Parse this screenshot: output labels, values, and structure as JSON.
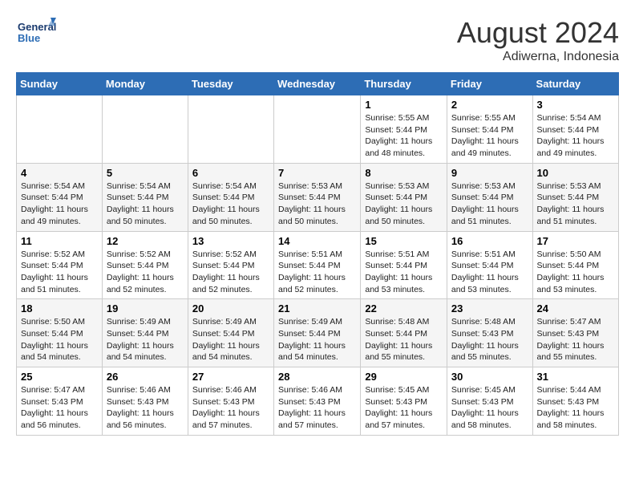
{
  "header": {
    "logo_line1": "General",
    "logo_line2": "Blue",
    "month": "August 2024",
    "location": "Adiwerna, Indonesia"
  },
  "weekdays": [
    "Sunday",
    "Monday",
    "Tuesday",
    "Wednesday",
    "Thursday",
    "Friday",
    "Saturday"
  ],
  "weeks": [
    [
      {
        "day": "",
        "info": ""
      },
      {
        "day": "",
        "info": ""
      },
      {
        "day": "",
        "info": ""
      },
      {
        "day": "",
        "info": ""
      },
      {
        "day": "1",
        "info": "Sunrise: 5:55 AM\nSunset: 5:44 PM\nDaylight: 11 hours and 48 minutes."
      },
      {
        "day": "2",
        "info": "Sunrise: 5:55 AM\nSunset: 5:44 PM\nDaylight: 11 hours and 49 minutes."
      },
      {
        "day": "3",
        "info": "Sunrise: 5:54 AM\nSunset: 5:44 PM\nDaylight: 11 hours and 49 minutes."
      }
    ],
    [
      {
        "day": "4",
        "info": "Sunrise: 5:54 AM\nSunset: 5:44 PM\nDaylight: 11 hours and 49 minutes."
      },
      {
        "day": "5",
        "info": "Sunrise: 5:54 AM\nSunset: 5:44 PM\nDaylight: 11 hours and 50 minutes."
      },
      {
        "day": "6",
        "info": "Sunrise: 5:54 AM\nSunset: 5:44 PM\nDaylight: 11 hours and 50 minutes."
      },
      {
        "day": "7",
        "info": "Sunrise: 5:53 AM\nSunset: 5:44 PM\nDaylight: 11 hours and 50 minutes."
      },
      {
        "day": "8",
        "info": "Sunrise: 5:53 AM\nSunset: 5:44 PM\nDaylight: 11 hours and 50 minutes."
      },
      {
        "day": "9",
        "info": "Sunrise: 5:53 AM\nSunset: 5:44 PM\nDaylight: 11 hours and 51 minutes."
      },
      {
        "day": "10",
        "info": "Sunrise: 5:53 AM\nSunset: 5:44 PM\nDaylight: 11 hours and 51 minutes."
      }
    ],
    [
      {
        "day": "11",
        "info": "Sunrise: 5:52 AM\nSunset: 5:44 PM\nDaylight: 11 hours and 51 minutes."
      },
      {
        "day": "12",
        "info": "Sunrise: 5:52 AM\nSunset: 5:44 PM\nDaylight: 11 hours and 52 minutes."
      },
      {
        "day": "13",
        "info": "Sunrise: 5:52 AM\nSunset: 5:44 PM\nDaylight: 11 hours and 52 minutes."
      },
      {
        "day": "14",
        "info": "Sunrise: 5:51 AM\nSunset: 5:44 PM\nDaylight: 11 hours and 52 minutes."
      },
      {
        "day": "15",
        "info": "Sunrise: 5:51 AM\nSunset: 5:44 PM\nDaylight: 11 hours and 53 minutes."
      },
      {
        "day": "16",
        "info": "Sunrise: 5:51 AM\nSunset: 5:44 PM\nDaylight: 11 hours and 53 minutes."
      },
      {
        "day": "17",
        "info": "Sunrise: 5:50 AM\nSunset: 5:44 PM\nDaylight: 11 hours and 53 minutes."
      }
    ],
    [
      {
        "day": "18",
        "info": "Sunrise: 5:50 AM\nSunset: 5:44 PM\nDaylight: 11 hours and 54 minutes."
      },
      {
        "day": "19",
        "info": "Sunrise: 5:49 AM\nSunset: 5:44 PM\nDaylight: 11 hours and 54 minutes."
      },
      {
        "day": "20",
        "info": "Sunrise: 5:49 AM\nSunset: 5:44 PM\nDaylight: 11 hours and 54 minutes."
      },
      {
        "day": "21",
        "info": "Sunrise: 5:49 AM\nSunset: 5:44 PM\nDaylight: 11 hours and 54 minutes."
      },
      {
        "day": "22",
        "info": "Sunrise: 5:48 AM\nSunset: 5:44 PM\nDaylight: 11 hours and 55 minutes."
      },
      {
        "day": "23",
        "info": "Sunrise: 5:48 AM\nSunset: 5:43 PM\nDaylight: 11 hours and 55 minutes."
      },
      {
        "day": "24",
        "info": "Sunrise: 5:47 AM\nSunset: 5:43 PM\nDaylight: 11 hours and 55 minutes."
      }
    ],
    [
      {
        "day": "25",
        "info": "Sunrise: 5:47 AM\nSunset: 5:43 PM\nDaylight: 11 hours and 56 minutes."
      },
      {
        "day": "26",
        "info": "Sunrise: 5:46 AM\nSunset: 5:43 PM\nDaylight: 11 hours and 56 minutes."
      },
      {
        "day": "27",
        "info": "Sunrise: 5:46 AM\nSunset: 5:43 PM\nDaylight: 11 hours and 57 minutes."
      },
      {
        "day": "28",
        "info": "Sunrise: 5:46 AM\nSunset: 5:43 PM\nDaylight: 11 hours and 57 minutes."
      },
      {
        "day": "29",
        "info": "Sunrise: 5:45 AM\nSunset: 5:43 PM\nDaylight: 11 hours and 57 minutes."
      },
      {
        "day": "30",
        "info": "Sunrise: 5:45 AM\nSunset: 5:43 PM\nDaylight: 11 hours and 58 minutes."
      },
      {
        "day": "31",
        "info": "Sunrise: 5:44 AM\nSunset: 5:43 PM\nDaylight: 11 hours and 58 minutes."
      }
    ]
  ]
}
